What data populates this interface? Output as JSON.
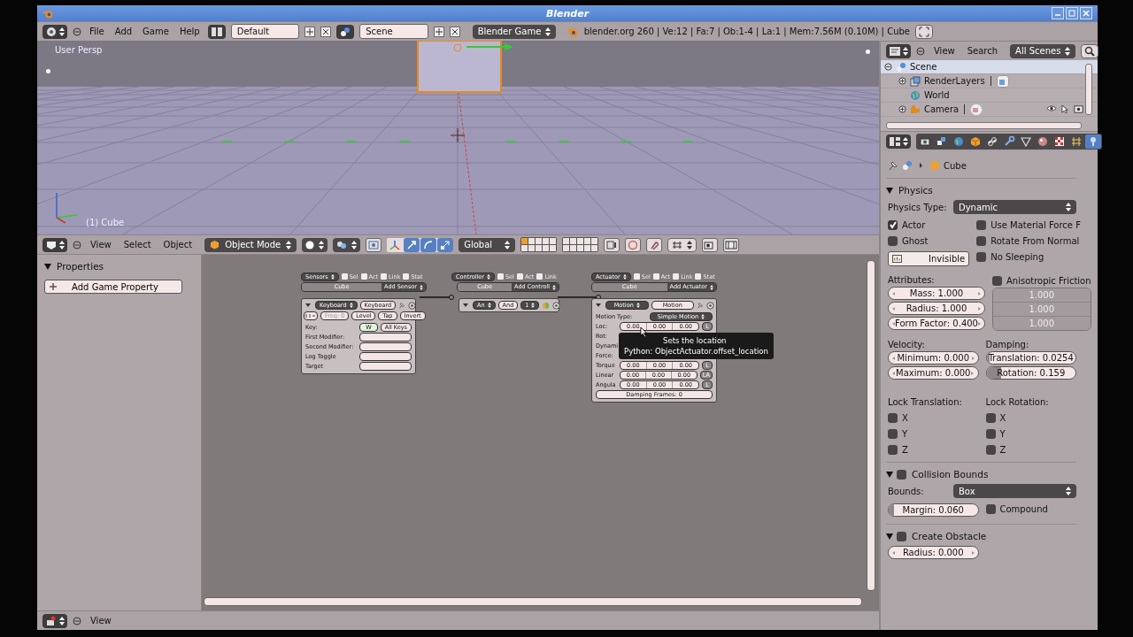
{
  "window": {
    "title": "Blender"
  },
  "info_header": {
    "menus": [
      "File",
      "Add",
      "Game",
      "Help"
    ],
    "screen_layout": "Default",
    "scene": "Scene",
    "render_engine": "Blender Game",
    "stats": "blender.org 260 | Ve:12 | Fa:7 | Ob:1-4 | La:1 | Mem:7.56M (0.10M) | Cube"
  },
  "viewport": {
    "view_label": "User Persp",
    "object_label": "(1) Cube"
  },
  "viewport_header": {
    "menus": [
      "View",
      "Select",
      "Object"
    ],
    "mode": "Object Mode",
    "orientation": "Global"
  },
  "logic_properties": {
    "title": "Properties",
    "expanded": true,
    "button": "Add Game Property"
  },
  "logic_columns": [
    {
      "kind": "sensor",
      "menu": "Sensors",
      "flags": [
        {
          "label": "Sel",
          "checked": true
        },
        {
          "label": "Act",
          "checked": true
        },
        {
          "label": "Link",
          "checked": true
        },
        {
          "label": "Stat",
          "checked": true
        }
      ],
      "object": "Cube",
      "add": "Add Sensor"
    },
    {
      "kind": "controller",
      "menu": "Controller",
      "flags": [
        {
          "label": "Sel",
          "checked": true
        },
        {
          "label": "Act",
          "checked": true
        },
        {
          "label": "Link",
          "checked": true
        }
      ],
      "object": "Cube",
      "add": "Add Controll"
    },
    {
      "kind": "actuator",
      "menu": "Actuator",
      "flags": [
        {
          "label": "Sel",
          "checked": true
        },
        {
          "label": "Act",
          "checked": true
        },
        {
          "label": "Link",
          "checked": true
        },
        {
          "label": "Stat",
          "checked": true
        }
      ],
      "object": "Cube",
      "add": "Add Actuator"
    }
  ],
  "sensor": {
    "type": "Keyboard",
    "name": "Keyboard",
    "freq": "Freq: 0",
    "level": "Level",
    "tap": "Tap",
    "invert": "Invert",
    "key_label": "Key:",
    "key": "W",
    "all_keys": "All Keys",
    "fields": [
      {
        "label": "First Modifier:"
      },
      {
        "label": "Second Modifier:"
      },
      {
        "label": "Log Toggle"
      },
      {
        "label": "Target"
      }
    ]
  },
  "controller": {
    "type": "An",
    "name": "And",
    "priority": "1"
  },
  "actuator": {
    "type": "Motion",
    "name": "Motion",
    "motion_type_label": "Motion Type:",
    "motion_type": "Simple Motion",
    "rows": [
      {
        "label": "Loc:",
        "values": [
          "0.00",
          "0.00",
          "0.00"
        ],
        "toggle": "L"
      },
      {
        "label": "Rot:"
      },
      {
        "label": "Dynami"
      },
      {
        "label": "Force:"
      },
      {
        "label": "Torque",
        "values": [
          "0.00",
          "0.00",
          "0.00"
        ],
        "toggle": "L"
      },
      {
        "label": "Linear",
        "values": [
          "0.00",
          "0.00",
          "0.00"
        ],
        "toggle": "LA"
      },
      {
        "label": "Angula",
        "values": [
          "0.00",
          "0.00",
          "0.00"
        ],
        "toggle": "L"
      }
    ],
    "damping": "Damping Frames: 0"
  },
  "tooltip": {
    "title": "Sets the location",
    "python": "Python: ObjectActuator.offset_location"
  },
  "bottom_header": {
    "menus": [
      "View"
    ]
  },
  "outliner": {
    "menus": [
      "View",
      "Search"
    ],
    "filter": "All Scenes",
    "items": [
      {
        "kind": "scene",
        "label": "Scene",
        "selected": true,
        "expanded": true,
        "children": [
          {
            "kind": "render_layers",
            "label": "RenderLayers",
            "selected": false,
            "expanded": false
          },
          {
            "kind": "world",
            "label": "World",
            "selected": false
          },
          {
            "kind": "camera",
            "label": "Camera",
            "selected": false,
            "expanded": false
          }
        ]
      }
    ]
  },
  "properties": {
    "tabs": [
      {
        "selected": false
      },
      {
        "selected": false
      },
      {
        "selected": false
      },
      {
        "selected": false
      },
      {
        "selected": false
      },
      {
        "selected": false
      },
      {
        "selected": false
      },
      {
        "selected": false
      },
      {
        "selected": false
      },
      {
        "selected": false
      },
      {
        "selected": true
      }
    ],
    "breadcrumb": "Cube",
    "physics": {
      "title": "Physics",
      "expanded": true,
      "type_label": "Physics Type:",
      "type": "Dynamic",
      "left_options": [
        {
          "label": "Actor",
          "checked": true
        },
        {
          "label": "Ghost",
          "checked": false
        }
      ],
      "invisible": {
        "label": "Invisible",
        "on": false
      },
      "right_options": [
        {
          "label": "Use Material Force F",
          "checked": false
        },
        {
          "label": "Rotate From Normal",
          "checked": false
        },
        {
          "label": "No Sleeping",
          "checked": false
        }
      ],
      "attributes_label": "Attributes:",
      "attributes": [
        "Mass: 1.000",
        "Radius: 1.000",
        "Form Factor: 0.400"
      ],
      "anisotropic": {
        "label": "Anisotropic Friction",
        "checked": false
      },
      "anisotropic_values": [
        "1.000",
        "1.000",
        "1.000"
      ],
      "velocity_label": "Velocity:",
      "velocity": [
        "Minimum: 0.000",
        "Maximum: 0.000"
      ],
      "damping_label": "Damping:",
      "damping": [
        {
          "text": "Translation: 0.0254",
          "level": 0.03
        },
        {
          "text": "Rotation: 0.159",
          "level": 0.16
        }
      ],
      "lock_translation": {
        "label": "Lock Translation:",
        "axes": [
          {
            "label": "X",
            "checked": false
          },
          {
            "label": "Y",
            "checked": false
          },
          {
            "label": "Z",
            "checked": false
          }
        ]
      },
      "lock_rotation": {
        "label": "Lock Rotation:",
        "axes": [
          {
            "label": "X",
            "checked": false
          },
          {
            "label": "Y",
            "checked": false
          },
          {
            "label": "Z",
            "checked": false
          }
        ]
      }
    },
    "collision_bounds": {
      "title": "Collision Bounds",
      "expanded": true,
      "enabled": false,
      "bounds_label": "Bounds:",
      "bounds": "Box",
      "margin": {
        "text": "Margin: 0.060",
        "level": 0.06
      },
      "compound": {
        "label": "Compound",
        "checked": false
      }
    },
    "create_obstacle": {
      "title": "Create Obstacle",
      "expanded": true,
      "enabled": false,
      "radius": "Radius: 0.000"
    }
  }
}
